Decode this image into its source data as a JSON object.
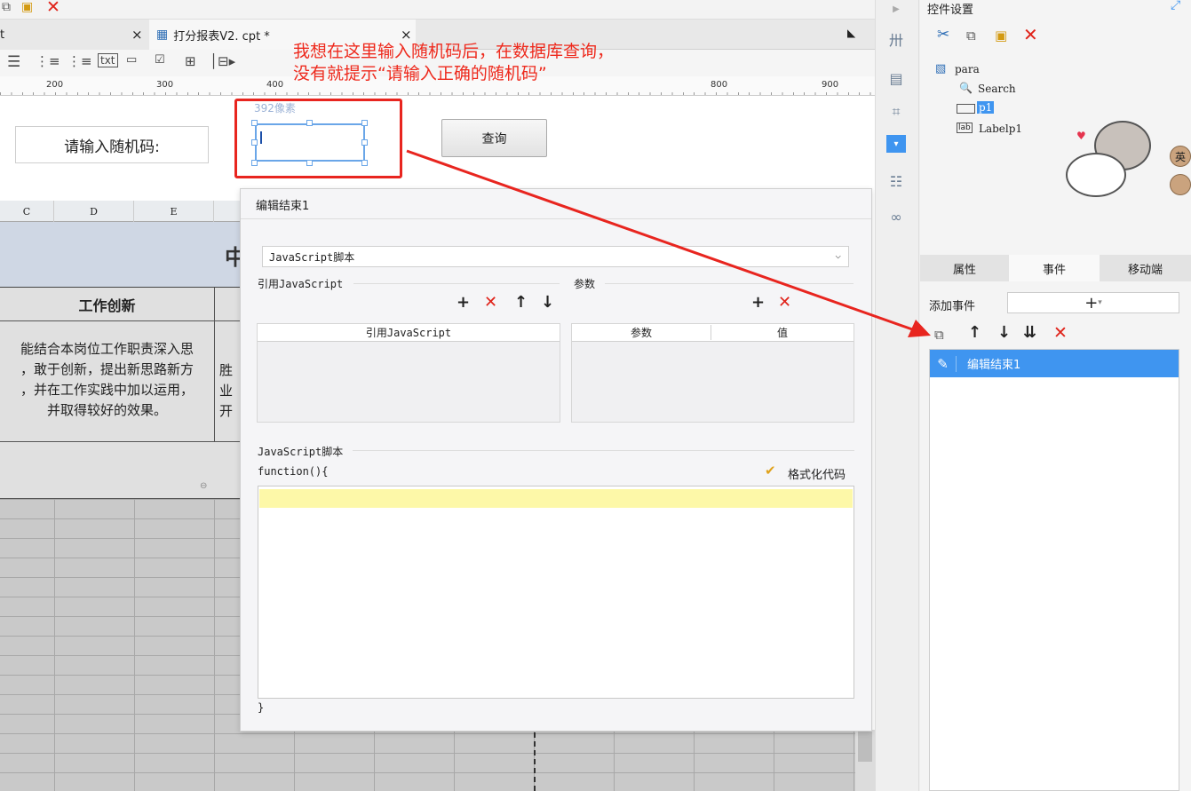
{
  "toolbar": {
    "cut": "✂",
    "copy": "⧉",
    "paste": "📋",
    "delete": "✕"
  },
  "tabs": [
    {
      "label": "t",
      "close": "×"
    },
    {
      "label": "打分报表V2. cpt *",
      "close": "×",
      "active": true
    }
  ],
  "ruler": {
    "ticks": [
      "200",
      "300",
      "400",
      "800",
      "900"
    ]
  },
  "annotation": {
    "line1": "我想在这里输入随机码后，在数据库查询，",
    "line2": "没有就提示“请输入正确的随机码”"
  },
  "para": {
    "prompt_label": "请输入随机码:",
    "search_button": "查询",
    "pixel_label": "392像素"
  },
  "sheet": {
    "columns": [
      "C",
      "D",
      "E"
    ],
    "banner_char": "中",
    "header": "工作创新",
    "body_lines": [
      "能结合本岗位工作职责深入思",
      "，敢于创新，提出新思路新方",
      "，并在工作实践中加以运用，",
      "并取得较好的效果。"
    ],
    "body2_lines": [
      "胜",
      "业",
      "开"
    ]
  },
  "dialog": {
    "title": "编辑结束1",
    "script_type": "JavaScript脚本",
    "ref_section": "引用JavaScript",
    "param_section": "参数",
    "ref_col": "引用JavaScript",
    "param_col": "参数",
    "value_col": "值",
    "script_section": "JavaScript脚本",
    "func_open": "function(){",
    "func_close": "}",
    "format_code": "格式化代码"
  },
  "right_panel": {
    "title": "控件设置",
    "tree": [
      "para",
      "Search",
      "p1",
      "Labelp1"
    ],
    "tabs": [
      "属性",
      "事件",
      "移动端"
    ],
    "add_event": "添加事件",
    "add_symbol": "+",
    "event_item": "编辑结束1",
    "ime_badge": "英"
  },
  "colors": {
    "accent": "#3f95f0",
    "annotation_red": "#ee2a1d",
    "highlight": "#fdf8a8"
  }
}
